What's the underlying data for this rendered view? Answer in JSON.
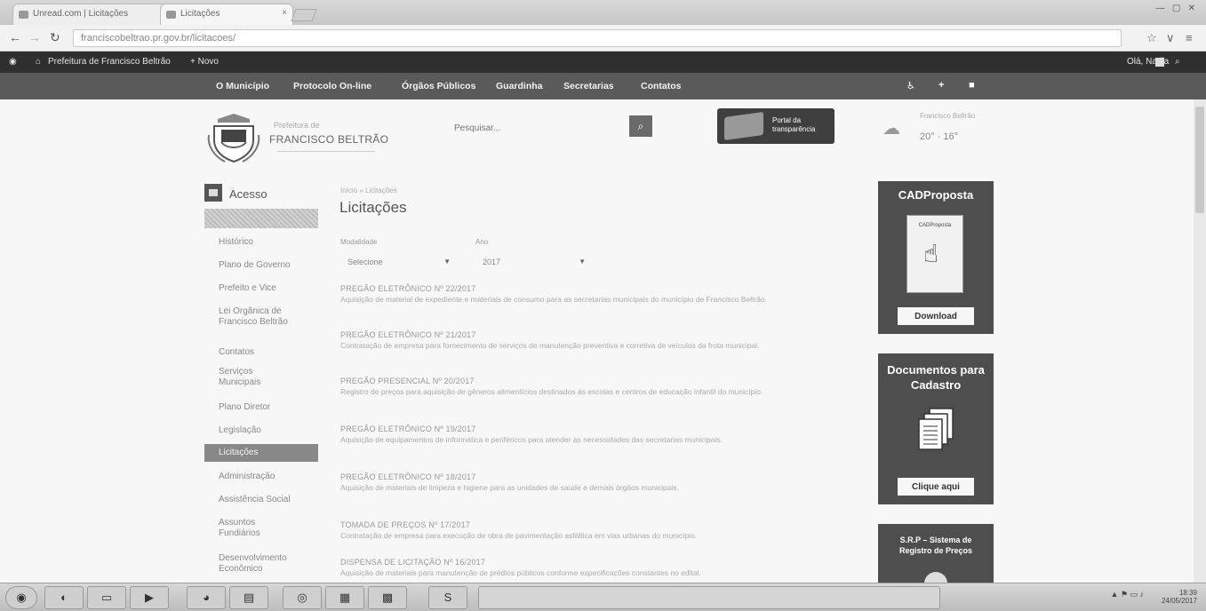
{
  "browser": {
    "tabs": [
      {
        "label": "Unread.com | Licitações"
      },
      {
        "label": "Licitações"
      }
    ],
    "url": "franciscobeltrao.pr.gov.br/licitacoes/"
  },
  "adminbar": {
    "site": "Prefeitura de Francisco Beltrão",
    "new": "+ Novo",
    "greeting": "Olá, Nadia"
  },
  "nav": {
    "items": [
      "O Município",
      "Protocolo On-line",
      "Órgãos Públicos",
      "Guardinha",
      "Secretarias",
      "Contatos"
    ]
  },
  "header": {
    "pre": "Prefeitura de",
    "brand": "FRANCISCO BELTRÃO",
    "search_placeholder": "Pesquisar...",
    "portal_line1": "Portal da",
    "portal_line2": "transparência",
    "weather_city": "Francisco Beltrão",
    "weather_temp": "20° · 16°"
  },
  "sidebar": {
    "title": "Acesso",
    "items": [
      "Histórico",
      "Plano de Governo",
      "Prefeito e Vice",
      "Lei Orgânica de Francisco Beltrão",
      "Contatos",
      "Serviços Municipais",
      "Plano Diretor",
      "Legislação",
      "Licitações",
      "Administração",
      "Assistência Social",
      "Assuntos Fundiários",
      "Desenvolvimento Econômico"
    ]
  },
  "content": {
    "breadcrumb": "Início » Licitações",
    "title": "Licitações",
    "filter_mod_label": "Modalidade",
    "filter_year_label": "Ano",
    "filter_mod_value": "Selecione",
    "filter_year_value": "2017",
    "items": [
      {
        "title": "PREGÃO ELETRÔNICO Nº 22/2017",
        "desc": "Aquisição de material de expediente e materiais de consumo para as secretarias municipais do município de Francisco Beltrão."
      },
      {
        "title": "PREGÃO ELETRÔNICO Nº 21/2017",
        "desc": "Contratação de empresa para fornecimento de serviços de manutenção preventiva e corretiva de veículos da frota municipal."
      },
      {
        "title": "PREGÃO PRESENCIAL Nº 20/2017",
        "desc": "Registro de preços para aquisição de gêneros alimentícios destinados às escolas e centros de educação infantil do município."
      },
      {
        "title": "PREGÃO ELETRÔNICO Nº 19/2017",
        "desc": "Aquisição de equipamentos de informática e periféricos para atender às necessidades das secretarias municipais."
      },
      {
        "title": "PREGÃO ELETRÔNICO Nº 18/2017",
        "desc": "Aquisição de materiais de limpeza e higiene para as unidades de saúde e demais órgãos municipais."
      },
      {
        "title": "TOMADA DE PREÇOS Nº 17/2017",
        "desc": "Contratação de empresa para execução de obra de pavimentação asfáltica em vias urbanas do município."
      },
      {
        "title": "DISPENSA DE LICITAÇÃO Nº 16/2017",
        "desc": "Aquisição de materiais para manutenção de prédios públicos conforme especificações constantes no edital."
      }
    ]
  },
  "right": {
    "cad_title": "CADProposta",
    "cad_box_label": "CADProposta",
    "cad_button": "Download",
    "docs_title": "Documentos para Cadastro",
    "docs_button": "Clique aqui",
    "srp_title": "S.R.P – Sistema de Registro de Preços"
  },
  "taskbar": {
    "time": "18:39",
    "date": "24/05/2017"
  }
}
